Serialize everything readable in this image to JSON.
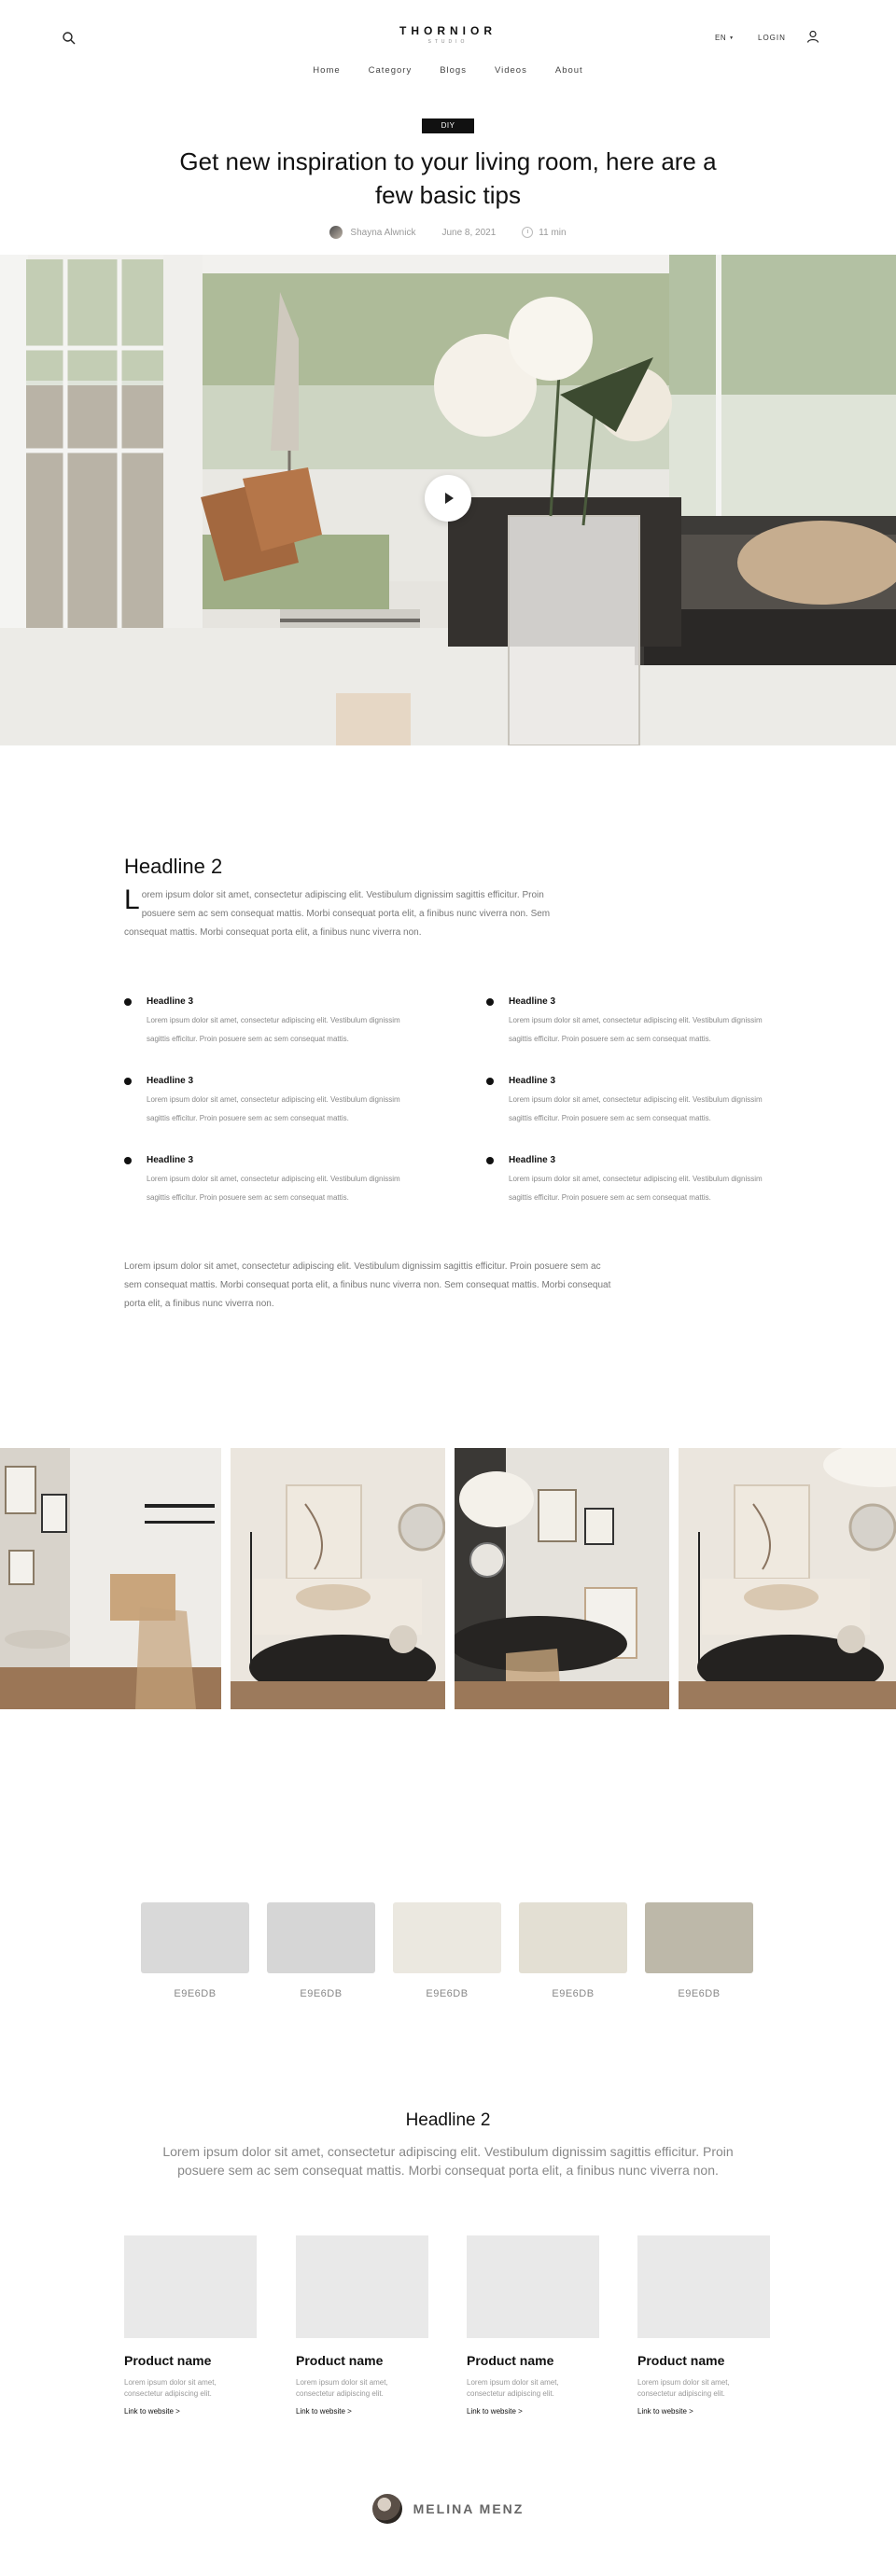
{
  "header": {
    "brand": "THORNIOR",
    "tagline": "STUDIO",
    "search_icon": "search-icon",
    "language": "EN",
    "login_label": "LOGIN",
    "user_icon": "user-icon"
  },
  "nav": {
    "items": [
      {
        "label": "Home"
      },
      {
        "label": "Category"
      },
      {
        "label": "Blogs"
      },
      {
        "label": "Videos"
      },
      {
        "label": "About"
      }
    ]
  },
  "article": {
    "badge": "DIY",
    "title": "Get new inspiration to your living room, here are a few basic tips",
    "author": "Shayna Alwnick",
    "date": "June 8, 2021",
    "read_time": "11 min",
    "headline": "Headline 2",
    "intro_dropcap": "L",
    "intro_text": "orem ipsum dolor sit amet, consectetur adipiscing elit. Vestibulum dignissim sagittis efficitur. Proin posuere sem ac sem consequat mattis. Morbi consequat porta elit, a finibus nunc viverra non. Sem consequat mattis. Morbi consequat porta elit, a finibus nunc viverra non.",
    "features": [
      {
        "title": "Headline 3",
        "text": "Lorem ipsum dolor sit amet, consectetur adipiscing elit. Vestibulum dignissim sagittis efficitur. Proin posuere sem ac sem consequat mattis."
      },
      {
        "title": "Headline 3",
        "text": "Lorem ipsum dolor sit amet, consectetur adipiscing elit. Vestibulum dignissim sagittis efficitur. Proin posuere sem ac sem consequat mattis."
      },
      {
        "title": "Headline 3",
        "text": "Lorem ipsum dolor sit amet, consectetur adipiscing elit. Vestibulum dignissim sagittis efficitur. Proin posuere sem ac sem consequat mattis."
      },
      {
        "title": "Headline 3",
        "text": "Lorem ipsum dolor sit amet, consectetur adipiscing elit. Vestibulum dignissim sagittis efficitur. Proin posuere sem ac sem consequat mattis."
      },
      {
        "title": "Headline 3",
        "text": "Lorem ipsum dolor sit amet, consectetur adipiscing elit. Vestibulum dignissim sagittis efficitur. Proin posuere sem ac sem consequat mattis."
      },
      {
        "title": "Headline 3",
        "text": "Lorem ipsum dolor sit amet, consectetur adipiscing elit. Vestibulum dignissim sagittis efficitur. Proin posuere sem ac sem consequat mattis."
      }
    ],
    "outro_text": "Lorem ipsum dolor sit amet, consectetur adipiscing elit. Vestibulum dignissim sagittis efficitur. Proin posuere sem ac sem consequat mattis. Morbi consequat porta elit, a finibus nunc viverra non. Sem consequat mattis. Morbi consequat porta elit, a finibus nunc viverra non."
  },
  "swatches": [
    {
      "code": "E9E6DB",
      "color": "#d9d9d9"
    },
    {
      "code": "E9E6DB",
      "color": "#d6d6d6"
    },
    {
      "code": "E9E6DB",
      "color": "#ebe8e0"
    },
    {
      "code": "E9E6DB",
      "color": "#e3dfd3"
    },
    {
      "code": "E9E6DB",
      "color": "#bdb8a9"
    }
  ],
  "products": {
    "headline": "Headline 2",
    "intro": "Lorem ipsum dolor sit amet, consectetur adipiscing elit. Vestibulum dignissim sagittis efficitur. Proin posuere sem ac sem consequat mattis. Morbi consequat porta elit, a finibus nunc viverra non.",
    "items": [
      {
        "name": "Product name",
        "desc": "Lorem ipsum dolor sit amet, consectetur adipiscing elit.",
        "link": "Link to website >"
      },
      {
        "name": "Product name",
        "desc": "Lorem ipsum dolor sit amet, consectetur adipiscing elit.",
        "link": "Link to website >"
      },
      {
        "name": "Product name",
        "desc": "Lorem ipsum dolor sit amet, consectetur adipiscing elit.",
        "link": "Link to website >"
      },
      {
        "name": "Product name",
        "desc": "Lorem ipsum dolor sit amet, consectetur adipiscing elit.",
        "link": "Link to website >"
      }
    ]
  },
  "footer": {
    "author_name": "MELINA MENZ"
  }
}
